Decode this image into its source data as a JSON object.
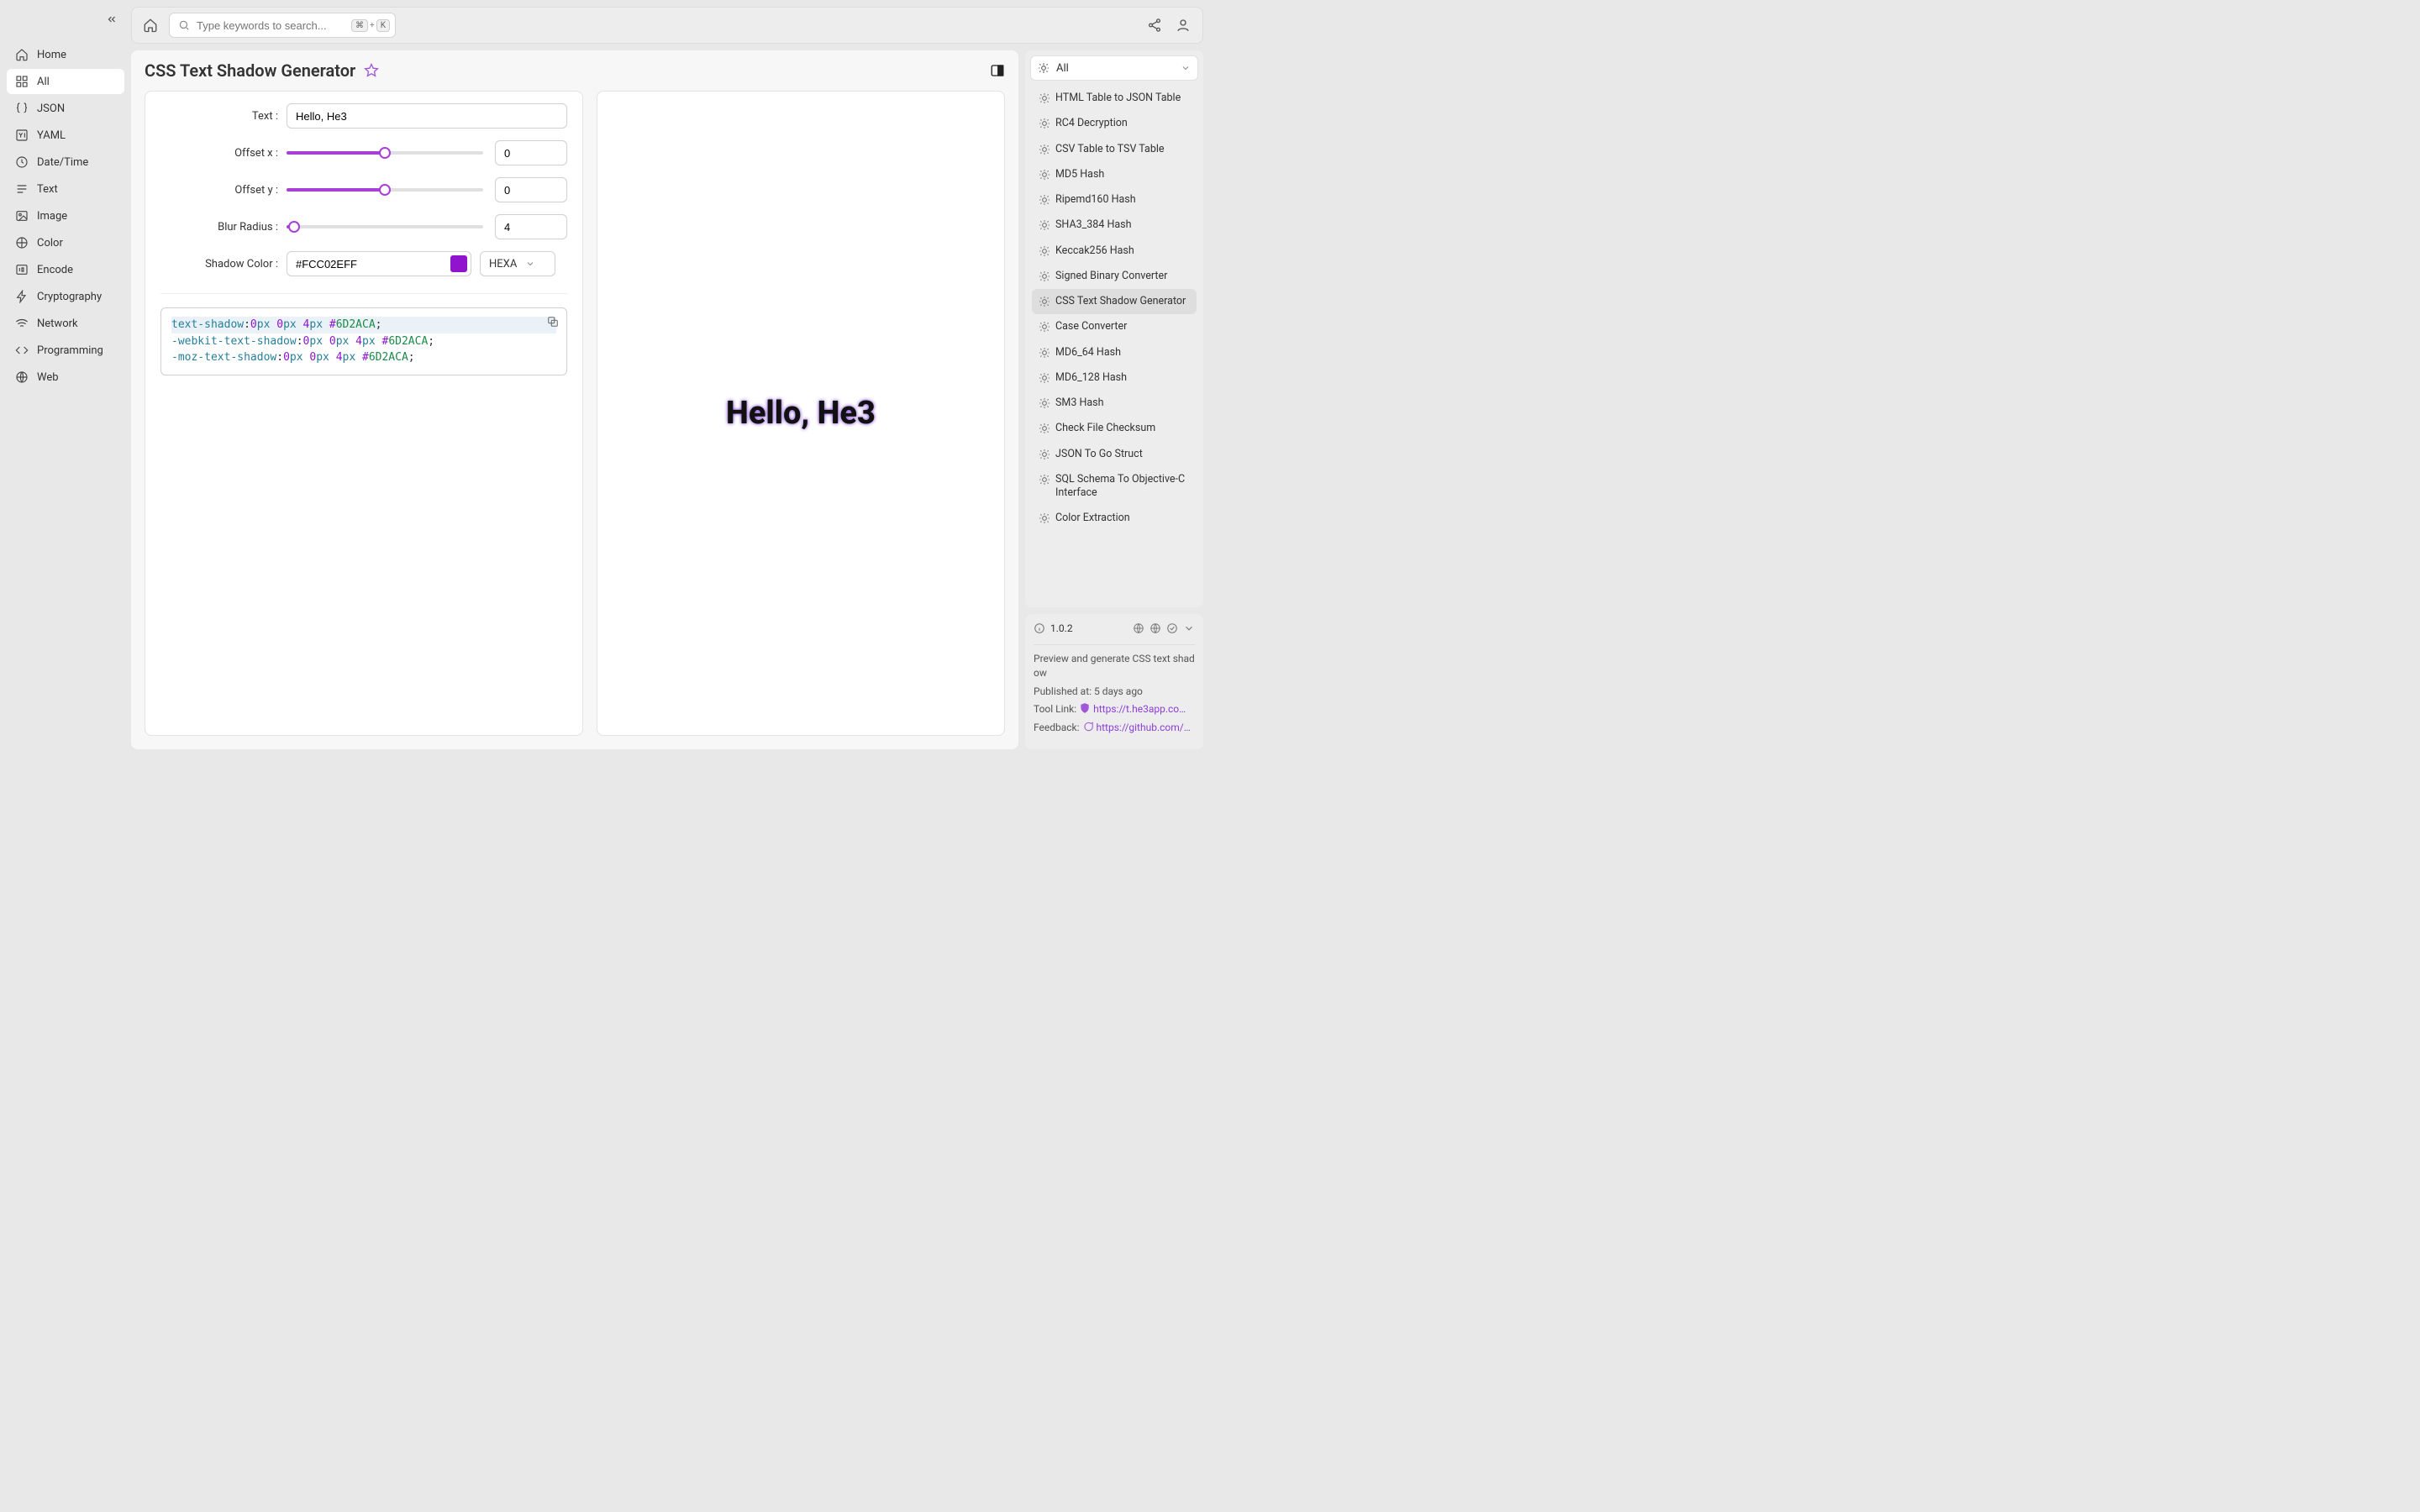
{
  "sidebar": {
    "items": [
      {
        "label": "Home",
        "icon": "home"
      },
      {
        "label": "All",
        "icon": "grid",
        "active": true
      },
      {
        "label": "JSON",
        "icon": "braces"
      },
      {
        "label": "YAML",
        "icon": "yaml"
      },
      {
        "label": "Date/Time",
        "icon": "clock"
      },
      {
        "label": "Text",
        "icon": "text"
      },
      {
        "label": "Image",
        "icon": "image"
      },
      {
        "label": "Color",
        "icon": "palette"
      },
      {
        "label": "Encode",
        "icon": "binary"
      },
      {
        "label": "Cryptography",
        "icon": "bolt"
      },
      {
        "label": "Network",
        "icon": "wifi"
      },
      {
        "label": "Programming",
        "icon": "code"
      },
      {
        "label": "Web",
        "icon": "globe"
      }
    ]
  },
  "topbar": {
    "search_placeholder": "Type keywords to search...",
    "kbd1": "⌘",
    "kbd_plus": "+",
    "kbd2": "K"
  },
  "page": {
    "title": "CSS Text Shadow Generator",
    "labels": {
      "text": "Text :",
      "offsetx": "Offset x :",
      "offsety": "Offset y :",
      "blur": "Blur Radius :",
      "shadow": "Shadow Color :"
    },
    "values": {
      "text": "Hello, He3",
      "offsetx": "0",
      "offsety": "0",
      "blur": "4",
      "color_hex": "#FCC02EFF",
      "color_format": "HEXA"
    },
    "sliders": {
      "offsetx_pct": 50,
      "offsety_pct": 50,
      "blur_pct": 4
    },
    "preview_color": "#9013ce",
    "code": {
      "l1_prop": "text-shadow",
      "l2_prop": "-webkit-text-shadow",
      "l3_prop": "-moz-text-shadow",
      "v0": "0",
      "unit": "px",
      "v1": "0",
      "v2": "4",
      "hex": "6D2ACA"
    },
    "preview_text": "Hello, He3"
  },
  "right": {
    "filter_label": "All",
    "tools": [
      {
        "label": "HTML Table to JSON Table"
      },
      {
        "label": "RC4 Decryption"
      },
      {
        "label": "CSV Table to TSV Table"
      },
      {
        "label": "MD5 Hash"
      },
      {
        "label": "Ripemd160 Hash"
      },
      {
        "label": "SHA3_384 Hash"
      },
      {
        "label": "Keccak256 Hash"
      },
      {
        "label": "Signed Binary Converter"
      },
      {
        "label": "CSS Text Shadow Generator",
        "active": true
      },
      {
        "label": "Case Converter"
      },
      {
        "label": "MD6_64 Hash"
      },
      {
        "label": "MD6_128 Hash"
      },
      {
        "label": "SM3 Hash"
      },
      {
        "label": "Check File Checksum"
      },
      {
        "label": "JSON To Go Struct"
      },
      {
        "label": "SQL Schema To Objective-C Interface"
      },
      {
        "label": "Color Extraction"
      }
    ],
    "meta": {
      "version": "1.0.2",
      "description": "Preview and generate CSS text shadow",
      "published_label": "Published at:",
      "published_value": "5 days ago",
      "tool_link_label": "Tool Link:",
      "tool_link_value": "https://t.he3app.co…",
      "feedback_label": "Feedback:",
      "feedback_value": "https://github.com/…"
    }
  }
}
